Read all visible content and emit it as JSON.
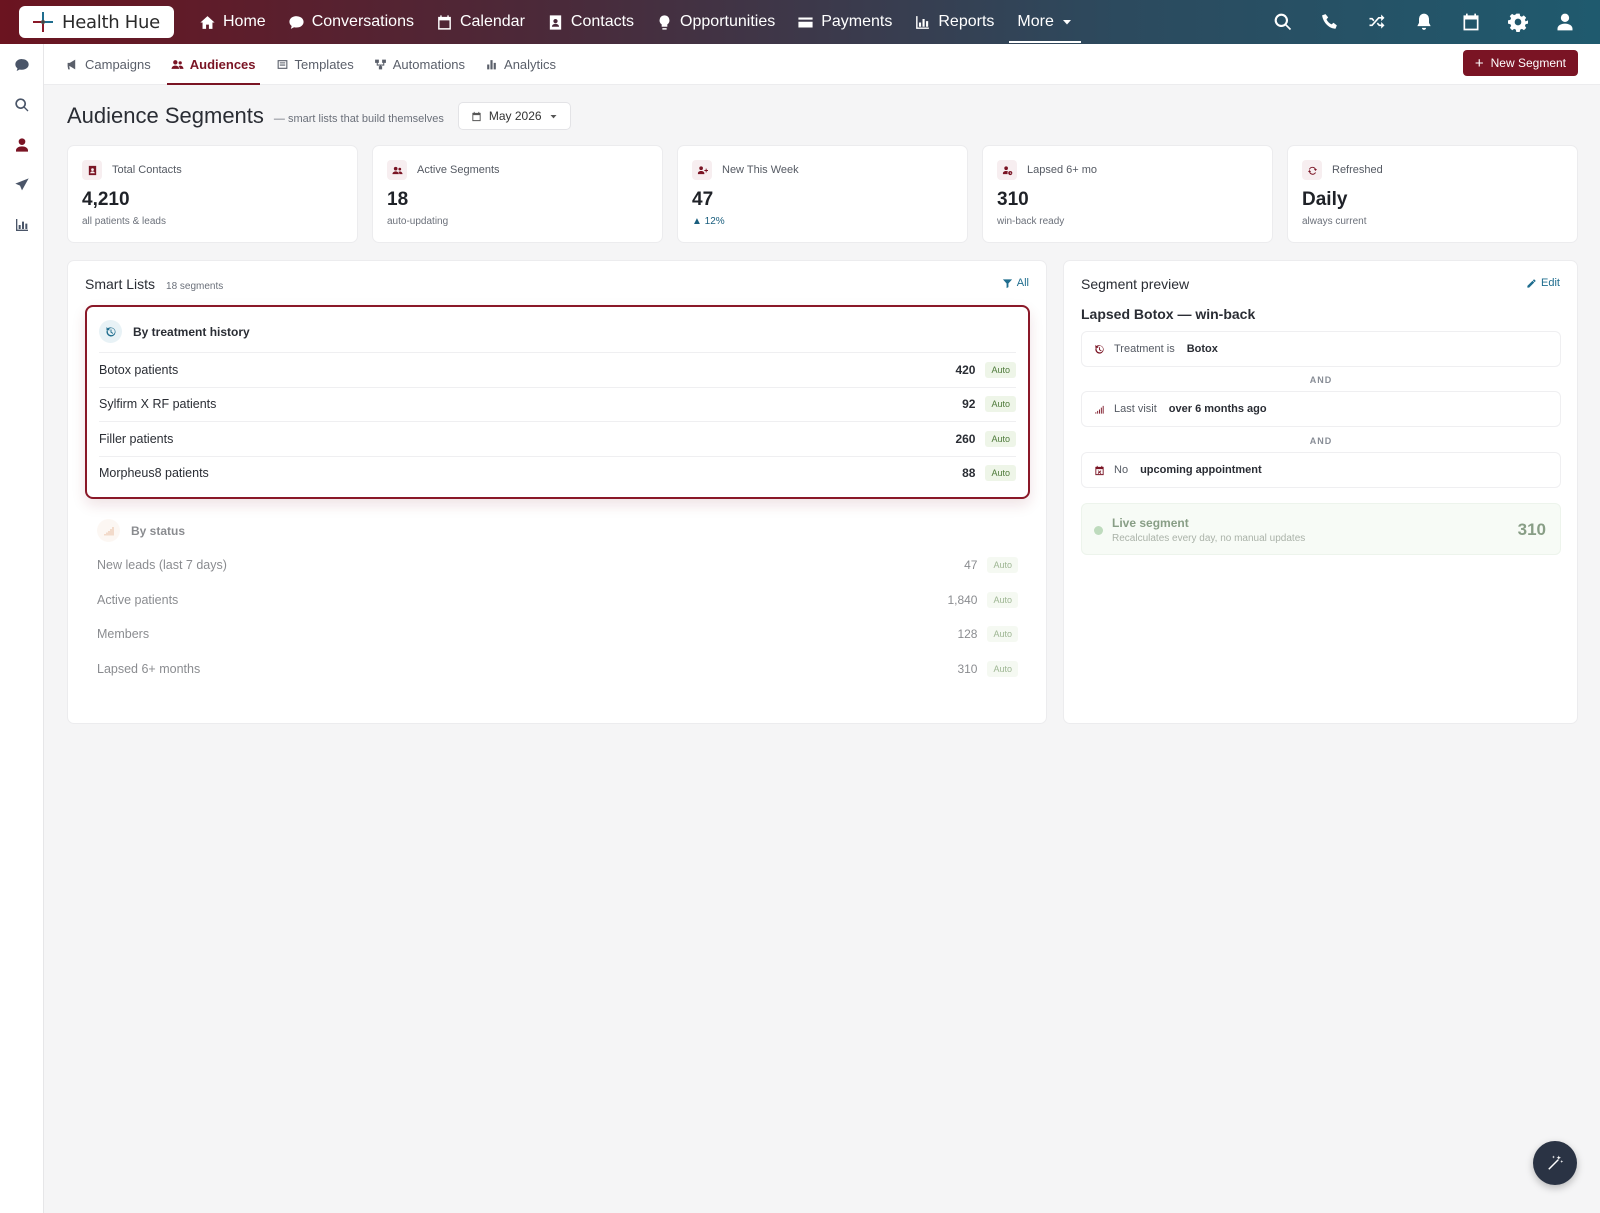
{
  "brand": {
    "name": "Health Hue"
  },
  "nav": {
    "items": [
      {
        "label": "Home",
        "icon": "home-icon"
      },
      {
        "label": "Conversations",
        "icon": "chat-icon"
      },
      {
        "label": "Calendar",
        "icon": "calendar-icon"
      },
      {
        "label": "Contacts",
        "icon": "contact-card-icon"
      },
      {
        "label": "Opportunities",
        "icon": "lightbulb-icon"
      },
      {
        "label": "Payments",
        "icon": "credit-card-icon"
      },
      {
        "label": "Reports",
        "icon": "bar-chart-icon"
      }
    ],
    "more_label": "More",
    "right_icons": [
      "search-icon",
      "phone-icon",
      "shuffle-icon",
      "bell-icon",
      "calendar-icon",
      "gear-icon",
      "user-icon"
    ]
  },
  "sidebar": {
    "icons": [
      "chat-icon",
      "search-icon",
      "user-icon",
      "send-icon",
      "bar-chart-icon"
    ],
    "active": "user-icon"
  },
  "subnav": {
    "items": [
      {
        "label": "Campaigns",
        "icon": "megaphone-icon"
      },
      {
        "label": "Audiences",
        "icon": "users-icon",
        "active": true
      },
      {
        "label": "Templates",
        "icon": "template-icon"
      },
      {
        "label": "Automations",
        "icon": "flow-icon"
      },
      {
        "label": "Analytics",
        "icon": "bar-chart-icon"
      }
    ],
    "new_button": "New Segment"
  },
  "page": {
    "title": "Audience Segments",
    "subtitle": "— smart lists that build themselves",
    "month": "May 2026"
  },
  "stats": [
    {
      "label": "Total Contacts",
      "value": "4,210",
      "note": "all patients & leads",
      "icon": "contact-card-icon"
    },
    {
      "label": "Active Segments",
      "value": "18",
      "note": "auto-updating",
      "icon": "users-icon"
    },
    {
      "label": "New This Week",
      "value": "47",
      "note": "▲ 12%",
      "icon": "user-plus-icon"
    },
    {
      "label": "Lapsed 6+ mo",
      "value": "310",
      "note": "win-back ready",
      "icon": "user-clock-icon"
    },
    {
      "label": "Refreshed",
      "value": "Daily",
      "note": "always current",
      "icon": "refresh-icon"
    }
  ],
  "smart_lists": {
    "title": "Smart Lists",
    "count": "18 segments",
    "filter_label": "All",
    "groups": [
      {
        "title": "By treatment history",
        "icon": "history-icon",
        "rows": [
          {
            "name": "Botox patients",
            "count": "420",
            "badge": "Auto"
          },
          {
            "name": "Sylfirm X RF patients",
            "count": "92",
            "badge": "Auto"
          },
          {
            "name": "Filler patients",
            "count": "260",
            "badge": "Auto"
          },
          {
            "name": "Morpheus8 patients",
            "count": "88",
            "badge": "Auto"
          }
        ]
      },
      {
        "title": "By status",
        "icon": "signal-icon",
        "rows": [
          {
            "name": "New leads (last 7 days)",
            "count": "47",
            "badge": "Auto"
          },
          {
            "name": "Active patients",
            "count": "1,840",
            "badge": "Auto"
          },
          {
            "name": "Members",
            "count": "128",
            "badge": "Auto"
          },
          {
            "name": "Lapsed 6+ months",
            "count": "310",
            "badge": "Auto"
          }
        ]
      }
    ]
  },
  "preview": {
    "title": "Segment preview",
    "edit_label": "Edit",
    "segment_name": "Lapsed Botox — win-back",
    "conditions": [
      {
        "label": "Treatment is",
        "value": "Botox",
        "icon": "history-icon"
      },
      {
        "label": "Last visit",
        "value": "over 6 months ago",
        "icon": "signal-icon"
      },
      {
        "label": "No",
        "value": "upcoming appointment",
        "icon": "calendar-x-icon"
      }
    ],
    "connector": "AND",
    "live": {
      "title": "Live segment",
      "subtitle": "Recalculates every day, no manual updates",
      "count": "310"
    }
  },
  "fab": {
    "icon": "magic-wand-icon"
  }
}
